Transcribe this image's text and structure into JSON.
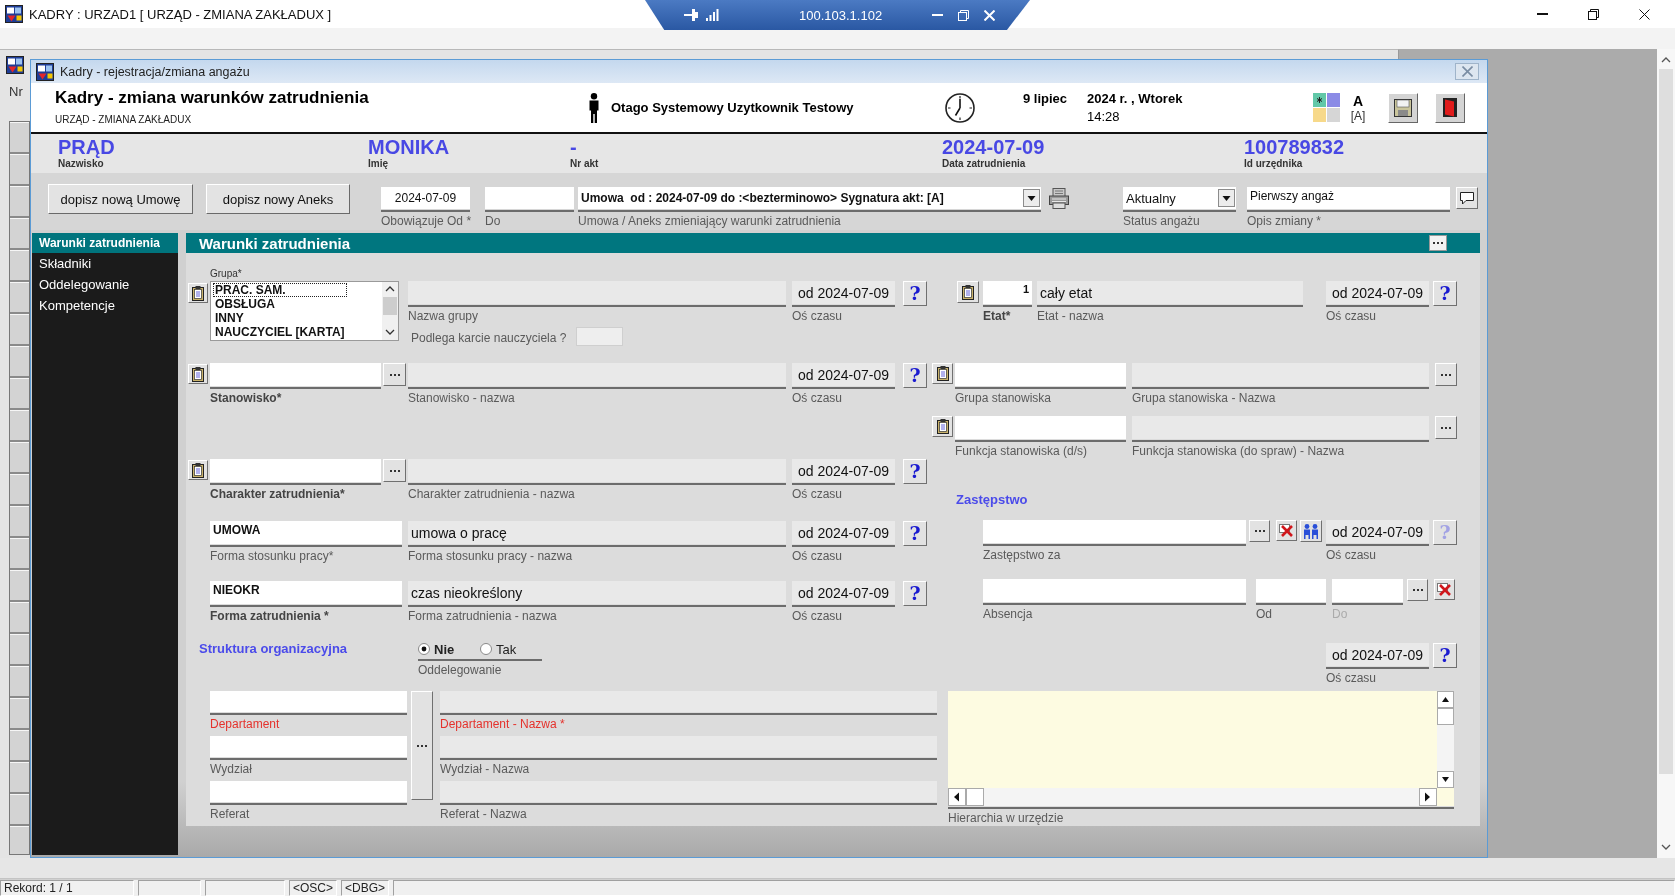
{
  "window": {
    "title": "KADRY : URZAD1 [ URZĄD - ZMIANA ZAKŁADUX ]"
  },
  "remote_bar": {
    "address": "100.103.1.102"
  },
  "background_window": {
    "column_header": "Nr"
  },
  "dialog": {
    "title": "Kadry - rejestracja/zmiana angażu"
  },
  "header": {
    "title": "Kadry - zmiana warunków zatrudnienia",
    "subtitle": "URZĄD - ZMIANA ZAKŁADUX",
    "user": "Otago Systemowy Uzytkownik Testowy",
    "date": "9 lipiec",
    "year_weekday": "2024 r. , Wtorek",
    "time": "14:28",
    "mode": "A",
    "mode_code": "[A]"
  },
  "employee": [
    {
      "value": "PRĄD",
      "label": "Nazwisko"
    },
    {
      "value": "MONIKA",
      "label": "Imię"
    },
    {
      "value": "-",
      "label": "Nr akt"
    },
    {
      "value": "2024-07-09",
      "label": "Data zatrudnienia"
    },
    {
      "value": "100789832",
      "label": "Id urzędnika"
    }
  ],
  "toolbar": {
    "buttons": [
      "dopisz nową Umowę",
      "dopisz nowy Aneks"
    ],
    "valid_from": {
      "value": "2024-07-09",
      "label": "Obowiązuje Od *"
    },
    "valid_to": {
      "label": "Do"
    },
    "contract": {
      "value": "Umowa  od : 2024-07-09 do :<bezterminowo> Sygnatura akt: [A]",
      "label": "Umowa / Aneks zmieniający warunki zatrudnienia"
    },
    "status": {
      "value": "Aktualny",
      "label": "Status angażu"
    },
    "change_description": {
      "value": "Pierwszy angaż",
      "label": "Opis zmiany *"
    }
  },
  "sidebar": {
    "items": [
      {
        "label": "Warunki zatrudnienia",
        "selected": true
      },
      {
        "label": "Składniki",
        "selected": false
      },
      {
        "label": "Oddelegowanie",
        "selected": false
      },
      {
        "label": "Kompetencje",
        "selected": false
      }
    ]
  },
  "panel": {
    "title": "Warunki zatrudnienia",
    "group": {
      "label": "Grupa*",
      "options": [
        {
          "label": "PRAC. SAM.",
          "selected": true
        },
        {
          "label": "OBSŁUGA",
          "selected": false
        },
        {
          "label": "INNY",
          "selected": false
        },
        {
          "label": "NAUCZYCIEL [KARTA]",
          "selected": false
        }
      ],
      "name_label": "Nazwa grupy",
      "timeline": {
        "value": "od 2024-07-09",
        "label": "Oś czasu",
        "help": "?",
        "help_disabled": false
      },
      "teacher_charter": "Podlega karcie nauczyciela ?"
    },
    "rows": [
      {
        "kind": "lookup",
        "code_label": "Stanowisko*",
        "label_bold": true,
        "name_label": "Stanowisko - nazwa",
        "timeline": {
          "value": "od 2024-07-09",
          "label": "Oś czasu",
          "help": "?",
          "help_disabled": false
        }
      },
      {
        "kind": "lookup",
        "code_label": "Charakter zatrudnienia*",
        "label_bold": true,
        "name_label": "Charakter zatrudnienia - nazwa",
        "timeline": {
          "value": "od 2024-07-09",
          "label": "Oś czasu",
          "help": "?",
          "help_disabled": false
        }
      },
      {
        "kind": "plain",
        "code": "UMOWA",
        "code_label": "Forma stosunku pracy*",
        "label_bold": false,
        "name": "umowa o pracę",
        "name_label": "Forma stosunku pracy - nazwa",
        "timeline": {
          "value": "od 2024-07-09",
          "label": "Oś czasu",
          "help": "?",
          "help_disabled": false
        }
      },
      {
        "kind": "plain",
        "code": "NIEOKR",
        "code_label": "Forma zatrudnienia *",
        "label_bold": true,
        "name": "czas nieokreślony",
        "name_label": "Forma zatrudnienia - nazwa",
        "timeline": {
          "value": "od 2024-07-09",
          "label": "Oś czasu",
          "help": "?",
          "help_disabled": false
        }
      }
    ],
    "fte": {
      "value": "1",
      "label": "Etat*",
      "label_bold": true,
      "name": "cały etat",
      "name_label": "Etat - nazwa",
      "timeline": {
        "value": "od 2024-07-09",
        "label": "Oś czasu",
        "help": "?",
        "help_disabled": false
      }
    },
    "position_groups": [
      {
        "label": "Grupa stanowiska",
        "name_label": "Grupa stanowiska - Nazwa"
      },
      {
        "label": "Funkcja stanowiska (d/s)",
        "name_label": "Funkcja stanowiska (do spraw) - Nazwa"
      }
    ],
    "substitution": {
      "heading": "Zastępstwo",
      "label": "Zastępstwo za",
      "timeline": {
        "value": "od 2024-07-09",
        "label": "Oś czasu",
        "help": "?",
        "help_disabled": true
      }
    },
    "absence": {
      "label": "Absencja",
      "from_label": "Od",
      "to_label": "Do",
      "to_disabled": true
    },
    "org_structure": {
      "heading": "Struktura organizacyjna",
      "secondment": {
        "label": "Oddelegowanie",
        "options": [
          {
            "label": "Nie",
            "selected": true
          },
          {
            "label": "Tak",
            "selected": false
          }
        ]
      },
      "timeline": {
        "value": "od 2024-07-09",
        "label": "Oś czasu",
        "help": "?",
        "help_disabled": false
      },
      "units": [
        {
          "label": "Departament",
          "name_label": "Departament - Nazwa *",
          "required": true
        },
        {
          "label": "Wydział",
          "name_label": "Wydział - Nazwa",
          "required": false
        },
        {
          "label": "Referat",
          "name_label": "Referat - Nazwa",
          "required": false
        }
      ],
      "hierarchy_label": "Hierarchia w urzędzie"
    }
  },
  "status_bar": {
    "record": "Rekord: 1 / 1",
    "flags": [
      "<OSC>",
      "<DBG>"
    ]
  }
}
